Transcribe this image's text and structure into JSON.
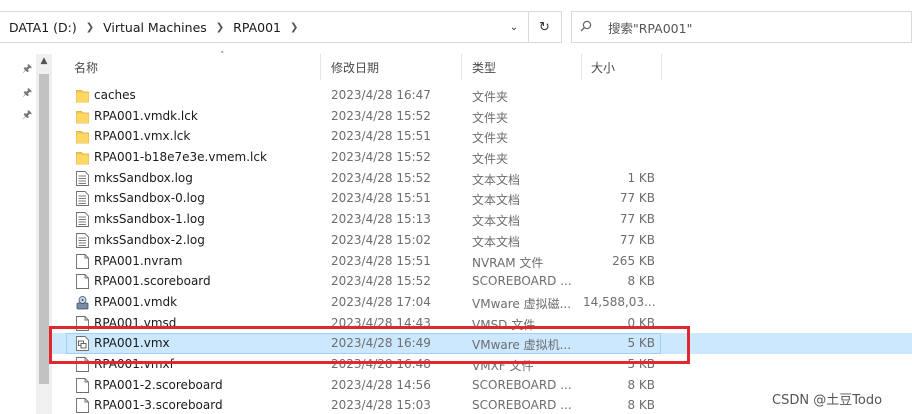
{
  "address": {
    "crumbs": [
      "DATA1 (D:)",
      "Virtual Machines",
      "RPA001"
    ],
    "dropdown_icon": "chevron-down-icon",
    "refresh_icon": "refresh-icon"
  },
  "search": {
    "placeholder": "搜索\"RPA001\""
  },
  "columns": {
    "name": "名称",
    "date": "修改日期",
    "type": "类型",
    "size": "大小"
  },
  "files": [
    {
      "name": "caches",
      "date": "2023/4/28 16:47",
      "type": "文件夹",
      "size": "",
      "icon": "folder-icon"
    },
    {
      "name": "RPA001.vmdk.lck",
      "date": "2023/4/28 15:52",
      "type": "文件夹",
      "size": "",
      "icon": "folder-icon"
    },
    {
      "name": "RPA001.vmx.lck",
      "date": "2023/4/28 15:51",
      "type": "文件夹",
      "size": "",
      "icon": "folder-icon"
    },
    {
      "name": "RPA001-b18e7e3e.vmem.lck",
      "date": "2023/4/28 15:52",
      "type": "文件夹",
      "size": "",
      "icon": "folder-icon"
    },
    {
      "name": "mksSandbox.log",
      "date": "2023/4/28 15:52",
      "type": "文本文档",
      "size": "1 KB",
      "icon": "text-file-icon"
    },
    {
      "name": "mksSandbox-0.log",
      "date": "2023/4/28 15:51",
      "type": "文本文档",
      "size": "77 KB",
      "icon": "text-file-icon"
    },
    {
      "name": "mksSandbox-1.log",
      "date": "2023/4/28 15:13",
      "type": "文本文档",
      "size": "77 KB",
      "icon": "text-file-icon"
    },
    {
      "name": "mksSandbox-2.log",
      "date": "2023/4/28 15:02",
      "type": "文本文档",
      "size": "77 KB",
      "icon": "text-file-icon"
    },
    {
      "name": "RPA001.nvram",
      "date": "2023/4/28 15:51",
      "type": "NVRAM 文件",
      "size": "265 KB",
      "icon": "blank-file-icon"
    },
    {
      "name": "RPA001.scoreboard",
      "date": "2023/4/28 15:52",
      "type": "SCOREBOARD ...",
      "size": "8 KB",
      "icon": "blank-file-icon"
    },
    {
      "name": "RPA001.vmdk",
      "date": "2023/4/28 17:04",
      "type": "VMware 虚拟磁...",
      "size": "14,588,03...",
      "icon": "vmdk-icon"
    },
    {
      "name": "RPA001.vmsd",
      "date": "2023/4/28 14:43",
      "type": "VMSD 文件",
      "size": "0 KB",
      "icon": "blank-file-icon"
    },
    {
      "name": "RPA001.vmx",
      "date": "2023/4/28 16:49",
      "type": "VMware 虚拟机...",
      "size": "5 KB",
      "icon": "vmx-icon",
      "selected": true
    },
    {
      "name": "RPA001.vmxf",
      "date": "2023/4/28 16:48",
      "type": "VMXF 文件",
      "size": "5 KB",
      "icon": "blank-file-icon"
    },
    {
      "name": "RPA001-2.scoreboard",
      "date": "2023/4/28 14:56",
      "type": "SCOREBOARD ...",
      "size": "8 KB",
      "icon": "blank-file-icon"
    },
    {
      "name": "RPA001-3.scoreboard",
      "date": "2023/4/28 15:03",
      "type": "SCOREBOARD ...",
      "size": "8 KB",
      "icon": "blank-file-icon"
    }
  ],
  "highlight_color": "#e0282e",
  "selection_color": "#cce8ff",
  "watermark": "CSDN @土豆Todo"
}
